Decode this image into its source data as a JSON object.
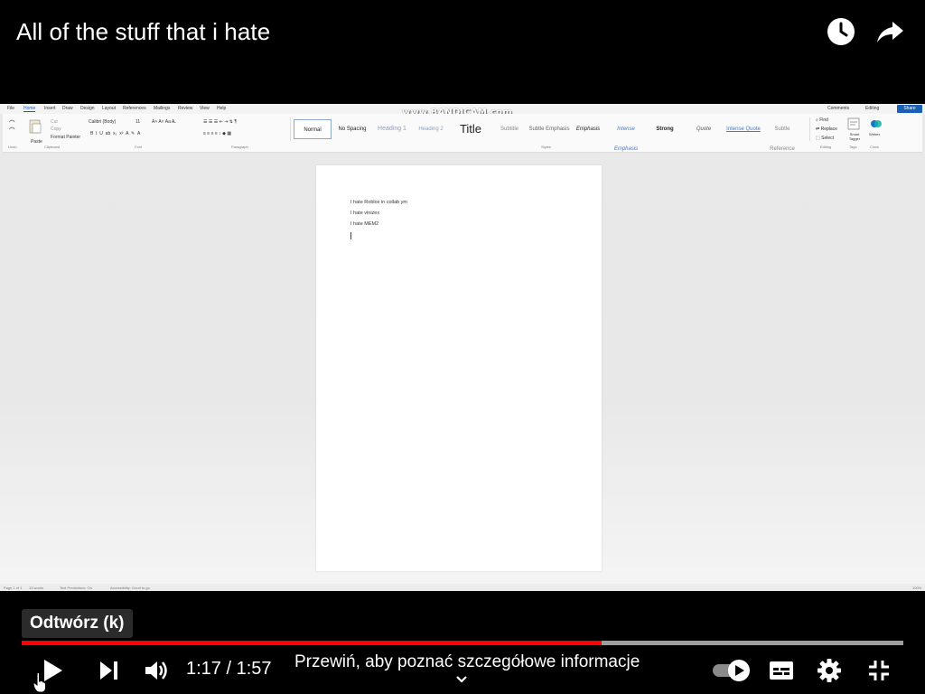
{
  "video": {
    "title": "All of the stuff that i hate",
    "watch_later_icon": "clock-icon",
    "share_icon": "share-arrow-icon",
    "watermark": "www.BANDICAM.com"
  },
  "word": {
    "menu_tabs": [
      "File",
      "Home",
      "Insert",
      "Draw",
      "Design",
      "Layout",
      "References",
      "Mailings",
      "Review",
      "View",
      "Help"
    ],
    "active_tab": "Home",
    "comments_label": "Comments",
    "editing_label": "Editing",
    "share_label": "Share",
    "font_name": "Calibri (Body)",
    "font_size": "11",
    "groups": [
      "Undo",
      "Clipboard",
      "Font",
      "Paragraph",
      "Styles",
      "Editing",
      "Tags",
      "Clock"
    ],
    "clipboard": {
      "paste": "Paste",
      "cut": "Cut",
      "copy": "Copy",
      "format_painter": "Format Painter"
    },
    "editing": {
      "find": "Find",
      "replace": "Replace",
      "select": "Select"
    },
    "tags": {
      "smart": "Smart Tagger"
    },
    "clock": {
      "webex": "Webex"
    },
    "styles": [
      "Normal",
      "No Spacing",
      "Heading 1",
      "Heading 2",
      "Title",
      "Subtitle",
      "Subtle Emphasis",
      "Emphasis",
      "Intense Emphasis",
      "Strong",
      "Quote",
      "Intense Quote",
      "Subtle Reference"
    ],
    "document_lines": [
      "I hate Roblox in collab ym",
      "I hate vinizex",
      "I hate MEM2"
    ],
    "status": {
      "page": "Page 1 of 1",
      "words": "13 words",
      "text_predictions": "Text Predictions: On",
      "accessibility": "Accessibility: Good to go",
      "zoom": "100%"
    }
  },
  "controls": {
    "tooltip": "Odtwórz (k)",
    "current_time": "1:17",
    "duration": "1:57",
    "time_display": "1:17 / 1:57",
    "progress_fraction": 0.658,
    "buffer_fraction": 1.0,
    "chapter_hint": "Przewiń, aby poznać szczegółowe informacje",
    "play_icon": "play-icon",
    "next_icon": "next-icon",
    "volume_icon": "volume-icon",
    "autoplay_icon": "autoplay-toggle-icon",
    "subtitles_icon": "subtitles-icon",
    "settings_icon": "settings-gear-icon",
    "fullscreen_icon": "exit-fullscreen-icon",
    "progress_color": "#ff0000"
  }
}
